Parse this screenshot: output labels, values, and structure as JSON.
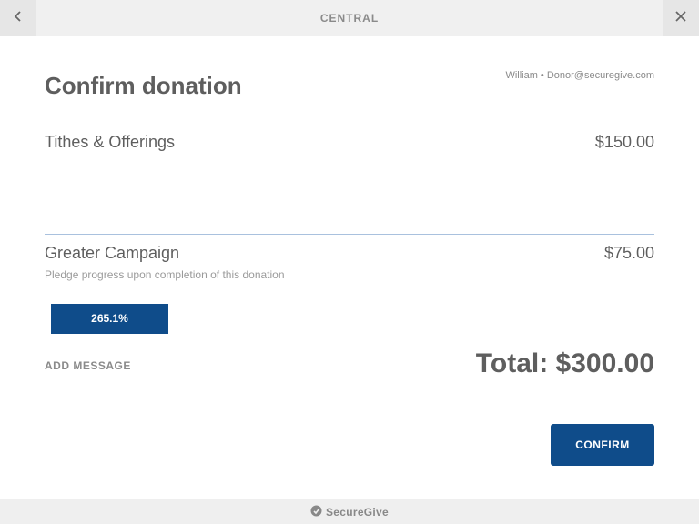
{
  "topbar": {
    "title": "CENTRAL",
    "back_icon": "chevron-left-icon",
    "close_icon": "close-icon"
  },
  "header": {
    "title": "Confirm donation",
    "user": "William • Donor@securegive.com"
  },
  "items": [
    {
      "name": "Tithes & Offerings",
      "amount": "$150.00"
    },
    {
      "name": "Greater Campaign",
      "amount": "$75.00"
    }
  ],
  "pledge": {
    "description": "Pledge progress upon completion of this donation",
    "progress_label": "265.1%",
    "progress_fraction": 1.0
  },
  "actions": {
    "add_message": "ADD MESSAGE",
    "confirm": "CONFIRM"
  },
  "total": {
    "label": "Total: $300.00"
  },
  "footer": {
    "brand": "SecureGive",
    "brand_icon": "securegive-logo-icon"
  },
  "colors": {
    "accent": "#0f4c8a",
    "divider": "#a9c1de",
    "text": "#5e5e5e"
  }
}
